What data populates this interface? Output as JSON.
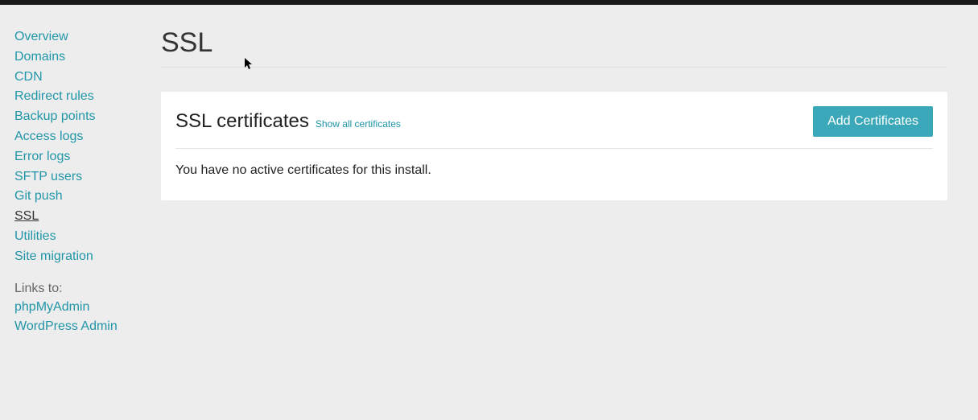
{
  "page": {
    "title": "SSL"
  },
  "sidebar": {
    "items": [
      {
        "label": "Overview"
      },
      {
        "label": "Domains"
      },
      {
        "label": "CDN"
      },
      {
        "label": "Redirect rules"
      },
      {
        "label": "Backup points"
      },
      {
        "label": "Access logs"
      },
      {
        "label": "Error logs"
      },
      {
        "label": "SFTP users"
      },
      {
        "label": "Git push"
      },
      {
        "label": "SSL"
      },
      {
        "label": "Utilities"
      },
      {
        "label": "Site migration"
      }
    ],
    "links_to_label": "Links to:",
    "external_links": [
      {
        "label": "phpMyAdmin"
      },
      {
        "label": "WordPress Admin"
      }
    ]
  },
  "panel": {
    "title": "SSL certificates",
    "show_all_label": "Show all certificates",
    "add_button_label": "Add Certificates",
    "empty_message": "You have no active certificates for this install."
  }
}
